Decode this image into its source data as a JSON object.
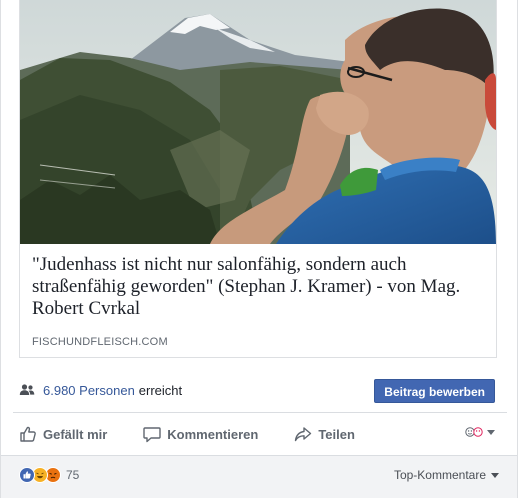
{
  "link_preview": {
    "title": "\"Judenhass ist nicht nur salonfähig, sondern auch straßenfähig geworden\" (Stephan J. Kramer) - von Mag. Robert Cvrkal",
    "domain": "FISCHUNDFLEISCH.COM",
    "image_icon": "photo-man-mountains"
  },
  "reach": {
    "icon": "people-icon",
    "count": "6.980 Personen",
    "suffix": "erreicht",
    "promote_label": "Beitrag bewerben"
  },
  "actions": {
    "like_label": "Gefällt mir",
    "comment_label": "Kommentieren",
    "share_label": "Teilen"
  },
  "reactions": {
    "types": [
      "like",
      "haha",
      "angry"
    ],
    "count": "75",
    "sort_label": "Top-Kommentare"
  },
  "colors": {
    "link_blue": "#365899",
    "button_blue": "#4267b2",
    "muted_text": "#606770"
  }
}
